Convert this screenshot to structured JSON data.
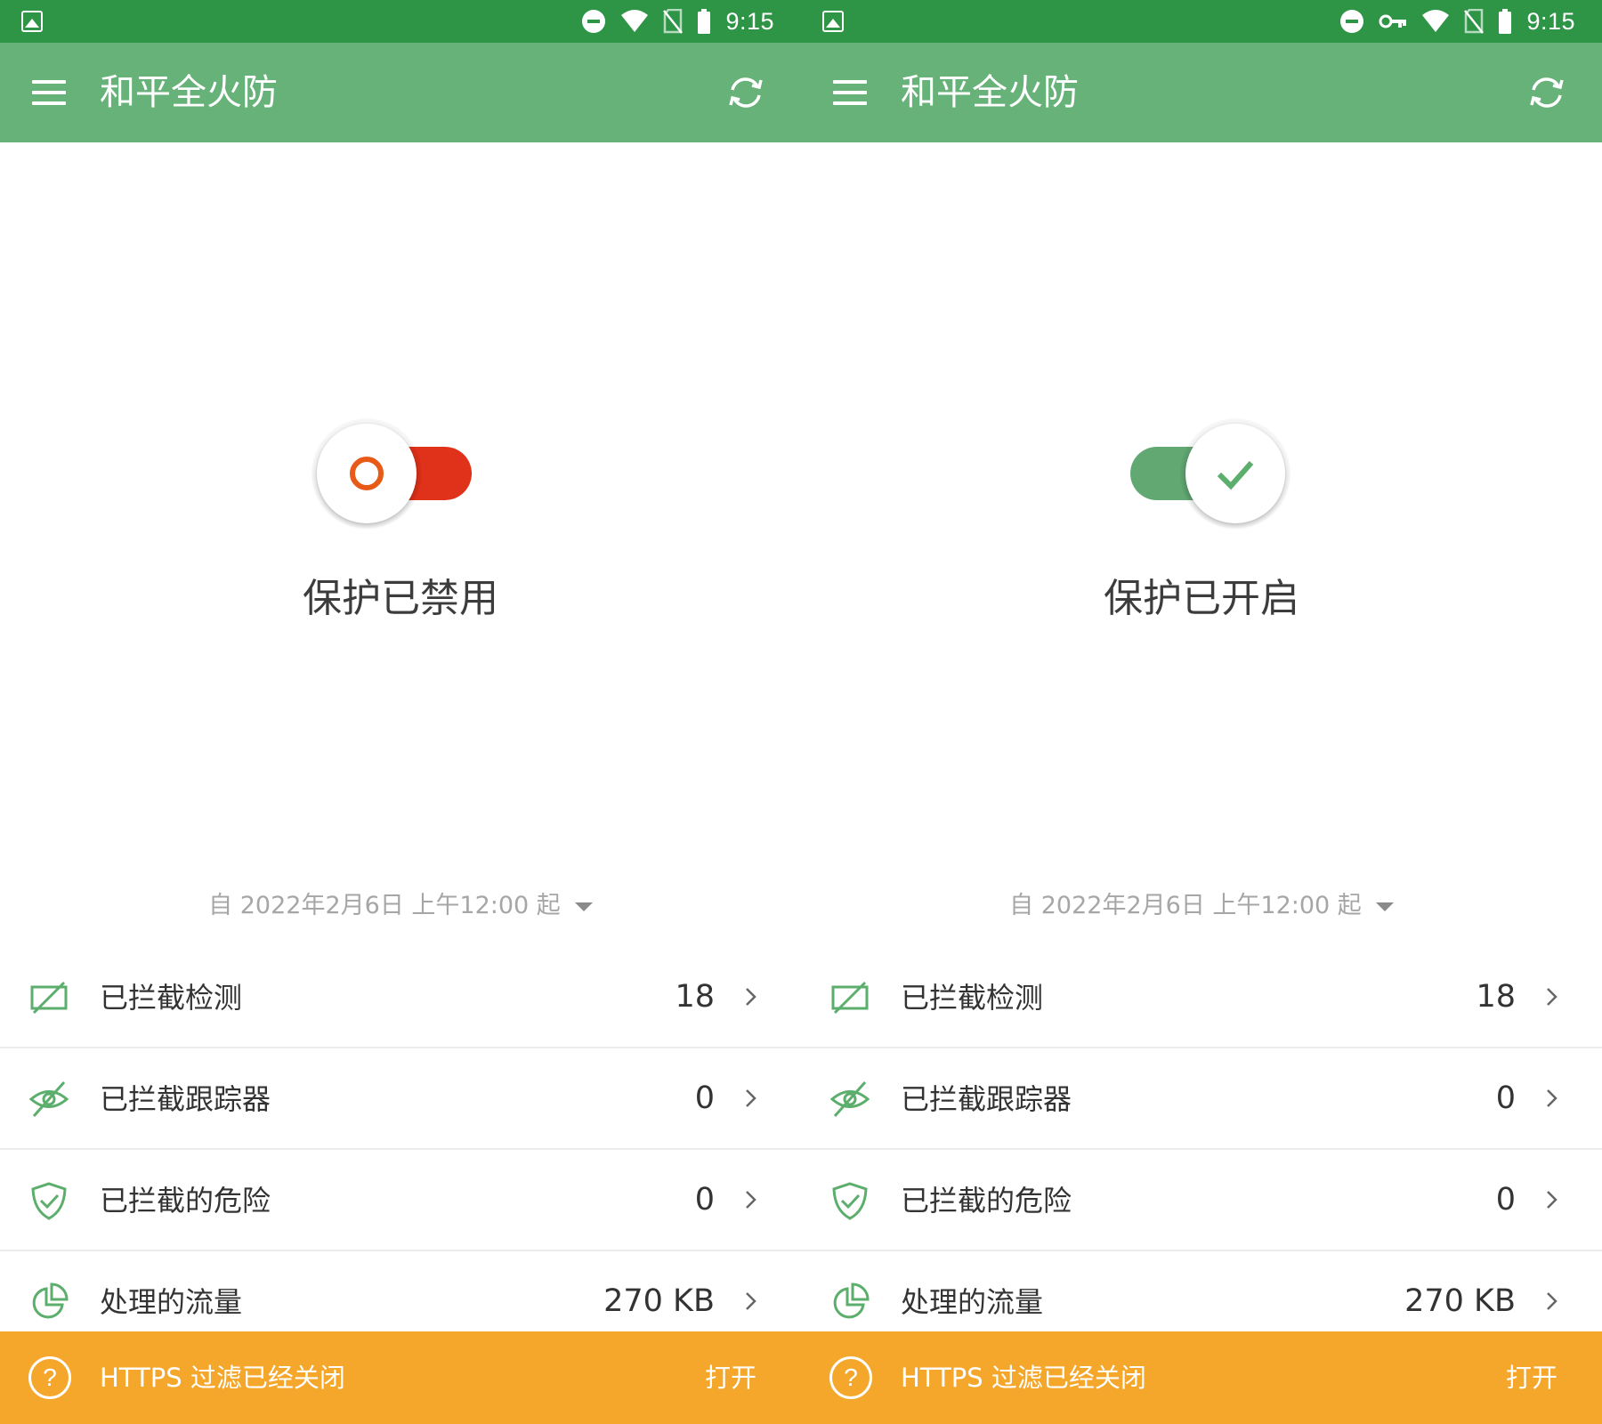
{
  "colors": {
    "status_bar": "#2e9547",
    "app_bar": "#67b279",
    "accent_green": "#5cae6c",
    "toggle_on_track": "#62a873",
    "toggle_off_track": "#e0321a",
    "toggle_off_ring": "#e85a17",
    "warning_banner": "#f4a72b"
  },
  "screens": [
    {
      "status_bar": {
        "time": "9:15",
        "icons": [
          "image-icon",
          "do-not-disturb-icon",
          "wifi-icon",
          "no-sim-icon",
          "battery-icon"
        ]
      },
      "app_bar": {
        "title": "和平全火防",
        "menu_icon": "hamburger-menu-icon",
        "action_icon": "refresh-icon"
      },
      "protection": {
        "enabled": false,
        "status_label": "保护已禁用",
        "knob_icon": "ring-icon"
      },
      "period": {
        "label": "自 2022年2月6日 上午12:00 起",
        "dropdown_icon": "caret-down-icon"
      },
      "stats": [
        {
          "icon": "ad-block-icon",
          "label": "已拦截检测",
          "value": "18"
        },
        {
          "icon": "tracker-block-icon",
          "label": "已拦截跟踪器",
          "value": "0"
        },
        {
          "icon": "shield-check-icon",
          "label": "已拦截的危险",
          "value": "0"
        },
        {
          "icon": "pie-chart-icon",
          "label": "处理的流量",
          "value": "270 KB"
        }
      ],
      "https_banner": {
        "icon": "help-circle-icon",
        "text": "HTTPS 过滤已经关闭",
        "action": "打开"
      }
    },
    {
      "status_bar": {
        "time": "9:15",
        "icons": [
          "image-icon",
          "do-not-disturb-icon",
          "vpn-key-icon",
          "wifi-icon",
          "no-sim-icon",
          "battery-icon"
        ]
      },
      "app_bar": {
        "title": "和平全火防",
        "menu_icon": "hamburger-menu-icon",
        "action_icon": "refresh-icon"
      },
      "protection": {
        "enabled": true,
        "status_label": "保护已开启",
        "knob_icon": "checkmark-icon"
      },
      "period": {
        "label": "自 2022年2月6日 上午12:00 起",
        "dropdown_icon": "caret-down-icon"
      },
      "stats": [
        {
          "icon": "ad-block-icon",
          "label": "已拦截检测",
          "value": "18"
        },
        {
          "icon": "tracker-block-icon",
          "label": "已拦截跟踪器",
          "value": "0"
        },
        {
          "icon": "shield-check-icon",
          "label": "已拦截的危险",
          "value": "0"
        },
        {
          "icon": "pie-chart-icon",
          "label": "处理的流量",
          "value": "270 KB"
        }
      ],
      "https_banner": {
        "icon": "help-circle-icon",
        "text": "HTTPS 过滤已经关闭",
        "action": "打开"
      }
    }
  ]
}
